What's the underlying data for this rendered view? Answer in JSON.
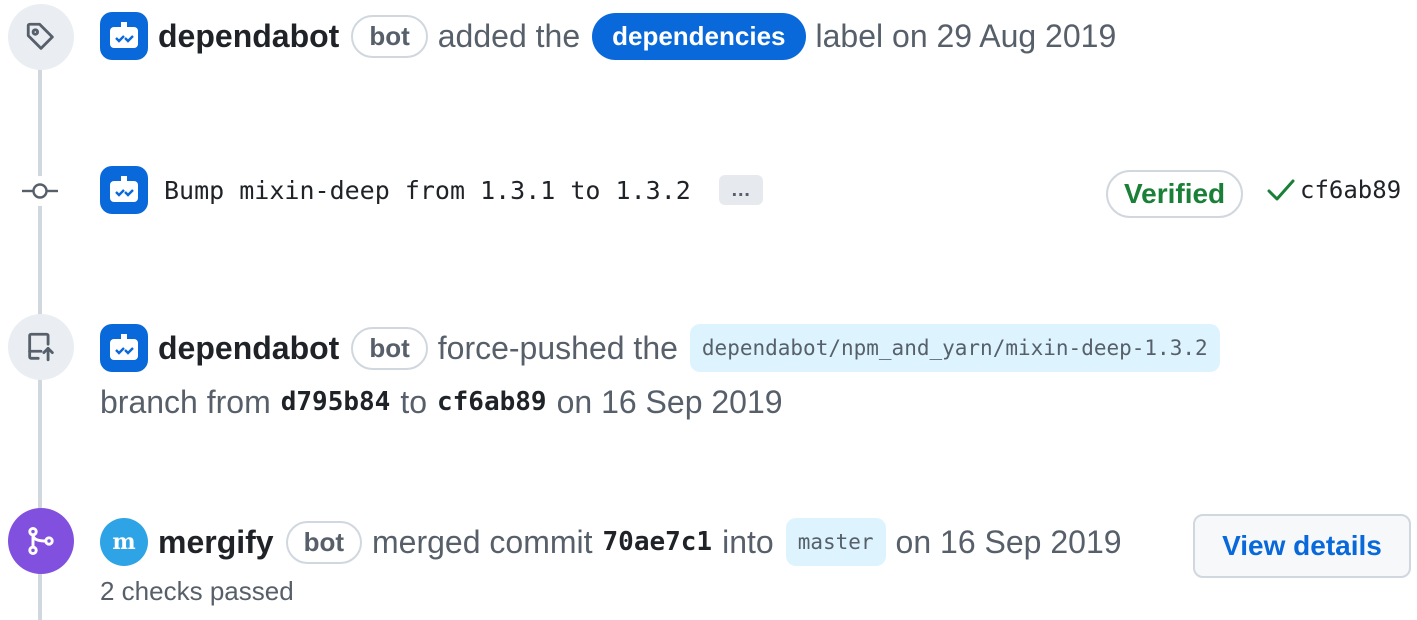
{
  "events": {
    "labeled": {
      "author": "dependabot",
      "bot_badge": "bot",
      "action": "added the",
      "label": "dependencies",
      "suffix": "label on 29 Aug 2019"
    },
    "commit": {
      "message": "Bump mixin-deep from 1.3.1 to 1.3.2",
      "ellipsis": "…",
      "verified": "Verified",
      "sha": "cf6ab89"
    },
    "force_push": {
      "author": "dependabot",
      "bot_badge": "bot",
      "action": "force-pushed the",
      "branch": "dependabot/npm_and_yarn/mixin-deep-1.3.2",
      "line2_prefix": "branch from",
      "from_sha": "d795b84",
      "to_word": "to",
      "to_sha": "cf6ab89",
      "date": "on 16 Sep 2019"
    },
    "merged": {
      "author": "mergify",
      "bot_badge": "bot",
      "action": "merged commit",
      "sha": "70ae7c1",
      "into_word": "into",
      "target_branch": "master",
      "date": "on 16 Sep 2019",
      "view_details": "View details",
      "checks": "2 checks passed"
    }
  },
  "icons": {
    "label_event": "tag-icon",
    "commit_event": "git-commit-icon",
    "force_push_event": "repo-push-icon",
    "merge_event": "git-merge-icon",
    "dependabot_avatar": "dependabot-icon",
    "mergify_avatar": "mergify-icon",
    "check": "check-icon"
  },
  "colors": {
    "accent": "#0969da",
    "merged": "#8250df",
    "verified": "#1a7f37",
    "muted": "#57606a",
    "border": "#d0d7de",
    "branch_bg": "#ddf4ff"
  }
}
